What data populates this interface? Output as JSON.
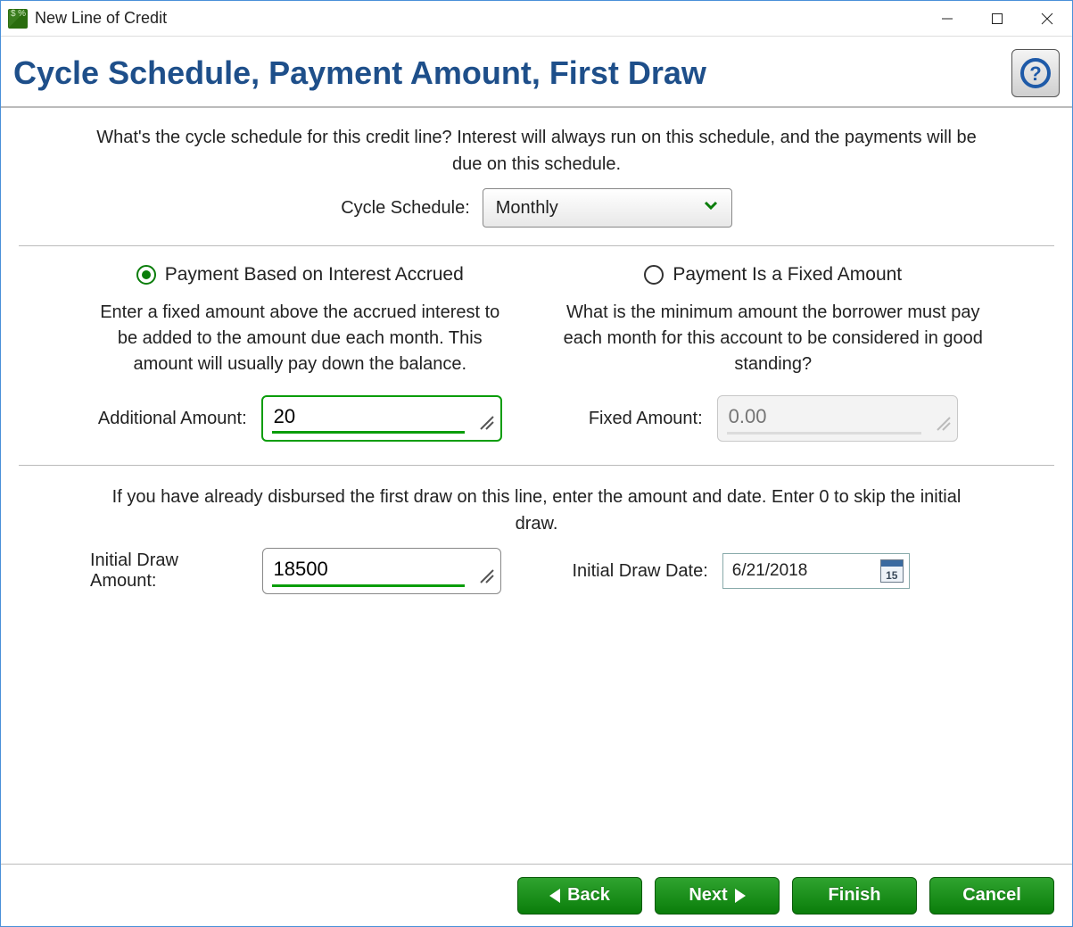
{
  "window": {
    "title": "New Line of Credit"
  },
  "header": {
    "title": "Cycle Schedule, Payment Amount, First Draw"
  },
  "intro": "What's the cycle schedule for this credit line?  Interest will always run on this schedule, and the payments will be due on this schedule.",
  "cycle": {
    "label": "Cycle Schedule:",
    "value": "Monthly"
  },
  "payment": {
    "interest": {
      "radio_label": "Payment Based on Interest Accrued",
      "checked": true,
      "desc": "Enter a fixed amount above the accrued interest to be added to the amount due each month.  This amount will usually pay down the balance.",
      "field_label": "Additional Amount:",
      "value": "20"
    },
    "fixed": {
      "radio_label": "Payment Is a Fixed Amount",
      "checked": false,
      "desc": "What is the minimum amount the borrower must pay each month for this account to be considered in good standing?",
      "field_label": "Fixed Amount:",
      "placeholder": "0.00"
    }
  },
  "draw": {
    "intro": "If you have already disbursed the first draw on this line, enter the amount and date.  Enter 0 to skip the initial draw.",
    "amount_label": "Initial Draw Amount:",
    "amount_value": "18500",
    "date_label": "Initial Draw Date:",
    "date_value": "6/21/2018",
    "cal_day": "15"
  },
  "buttons": {
    "back": "Back",
    "next": "Next",
    "finish": "Finish",
    "cancel": "Cancel"
  }
}
